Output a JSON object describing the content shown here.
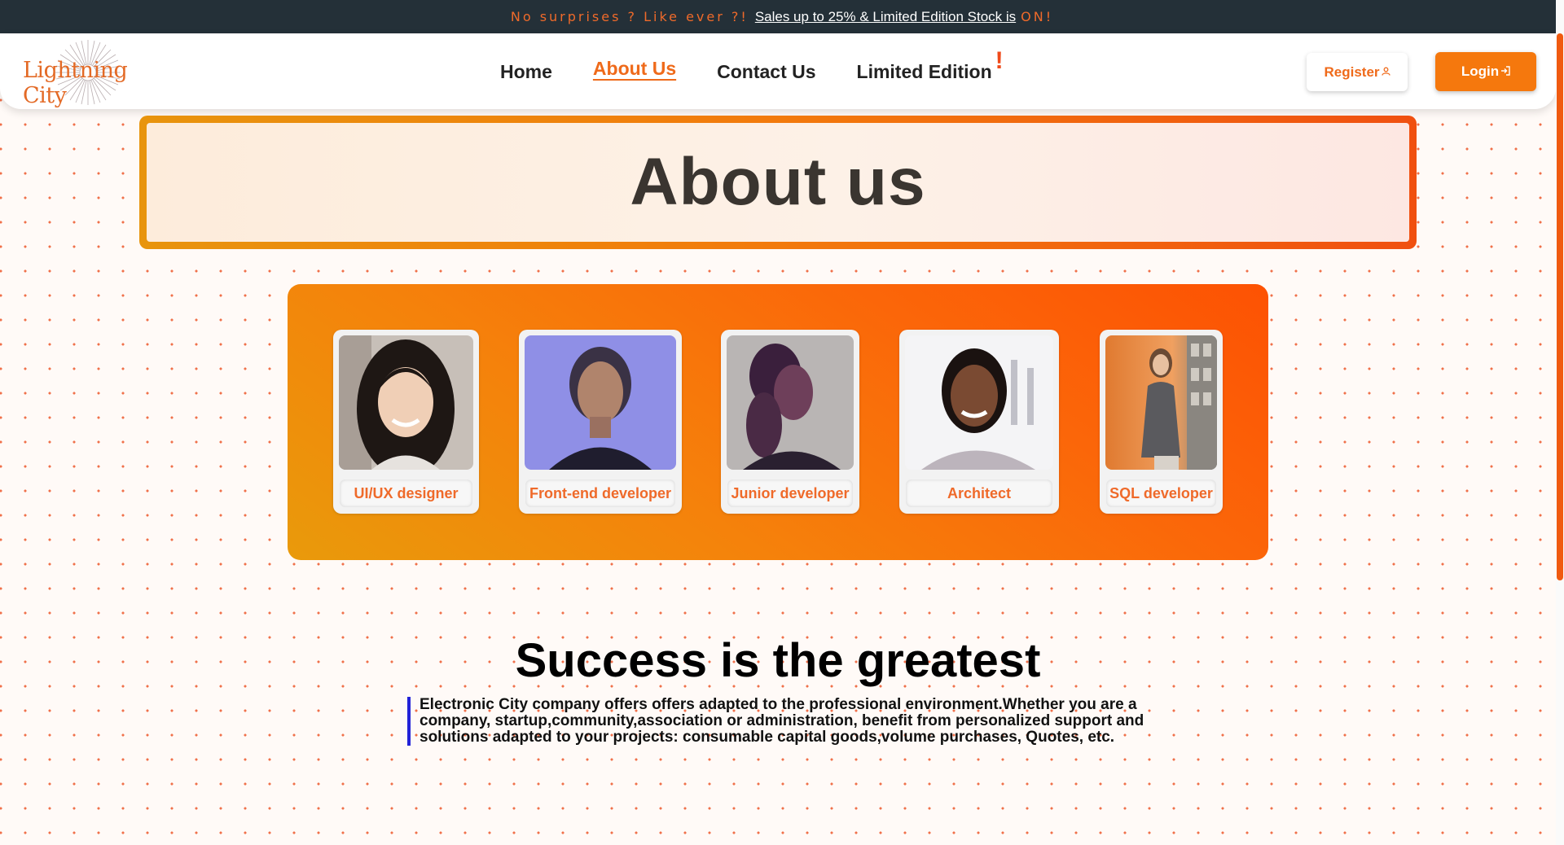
{
  "promo": {
    "lead": "No surprises ? Like ever ?!",
    "link": "Sales up to 25% & Limited Edition Stock is",
    "suffix": "ON!"
  },
  "brand": {
    "logo_text": "Lightning City",
    "accent": "#ef6a1a"
  },
  "nav": {
    "items": [
      {
        "label": "Home"
      },
      {
        "label": "About Us"
      },
      {
        "label": "Contact Us"
      },
      {
        "label": "Limited Edition"
      }
    ],
    "active": "About Us",
    "limited_badge": "!",
    "register_label": "Register",
    "login_label": "Login"
  },
  "about": {
    "title": "About us"
  },
  "team": [
    {
      "role": "UI/UX designer"
    },
    {
      "role": "Front-end developer"
    },
    {
      "role": "Junior developer"
    },
    {
      "role": "Architect"
    },
    {
      "role": "SQL developer"
    }
  ],
  "success": {
    "title": "Success is the greatest",
    "text": "Electronic City company offers offers adapted to the professional environment.Whether you are a company, startup,community,association or administration, benefit from personalized support and solutions adapted to your projects: consumable capital goods,volume purchases, Quotes, etc."
  }
}
